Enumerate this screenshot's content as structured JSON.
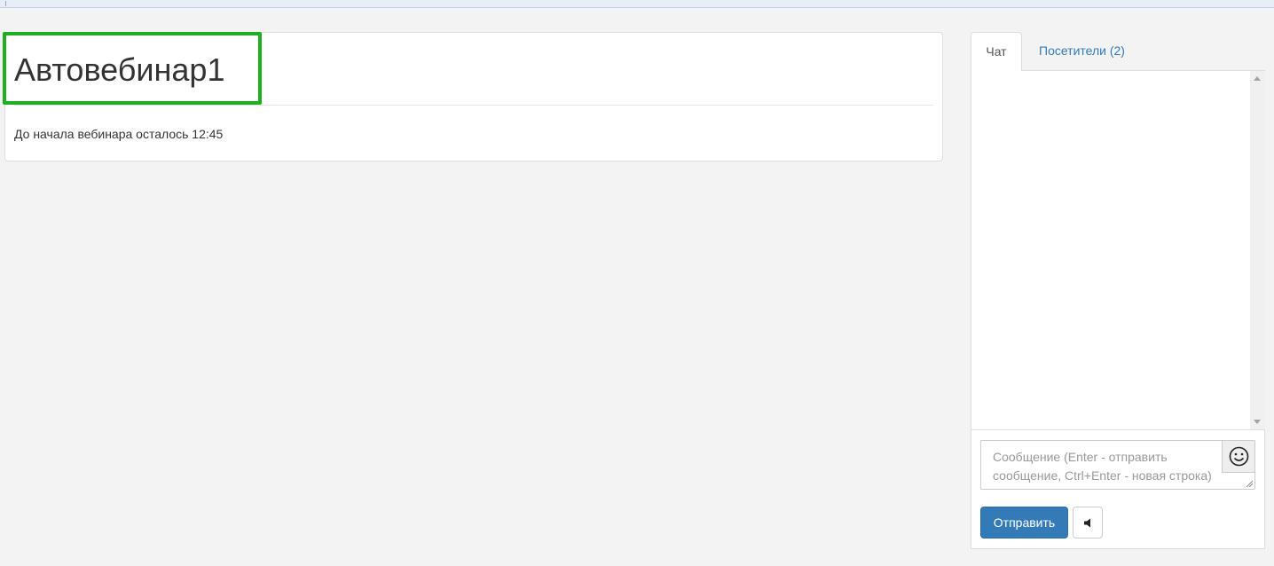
{
  "webinar": {
    "title": "Автовебинар1",
    "countdown": "До начала вебинара осталось 12:45"
  },
  "sidebar": {
    "tabs": [
      {
        "label": "Чат",
        "active": true
      },
      {
        "label": "Посетители (2)",
        "active": false
      }
    ],
    "composer": {
      "placeholder": "Сообщение (Enter - отправить сообщение, Ctrl+Enter - новая строка)",
      "value": "",
      "emoji_icon": "smiley-icon",
      "send_label": "Отправить",
      "sound_icon": "speaker-icon"
    }
  },
  "colors": {
    "page_background": "#f3f3f3",
    "highlight_border": "#1fae1f",
    "primary_button": "#337ab7",
    "link": "#337ab7"
  }
}
